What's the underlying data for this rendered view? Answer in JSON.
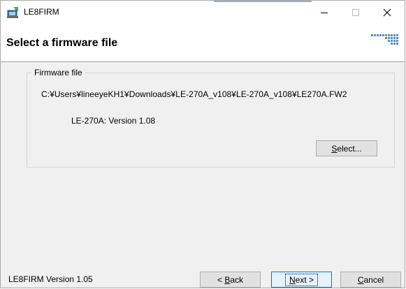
{
  "window": {
    "title": "LE8FIRM",
    "icon": "app-icon",
    "controls": {
      "minimize": "—",
      "maximize": "☐",
      "close": "✕"
    }
  },
  "header": {
    "title": "Select a firmware file",
    "logo": "dot-matrix-logo"
  },
  "firmware_group": {
    "legend": "Firmware file",
    "path": "C:¥Users¥lineeyeKH1¥Downloads¥LE-270A_v108¥LE-270A_v108¥LE270A.FW2",
    "version_info": "LE-270A: Version 1.08",
    "select_button": {
      "prefix": "",
      "accel": "S",
      "rest": "elect..."
    }
  },
  "footer": {
    "version_text": "LE8FIRM Version 1.05",
    "back_button": {
      "prefix": "< ",
      "accel": "B",
      "rest": "ack"
    },
    "next_button": {
      "prefix": "",
      "accel": "N",
      "rest": "ext >"
    },
    "cancel_button": {
      "prefix": "",
      "accel": "C",
      "rest": "ancel"
    }
  },
  "colors": {
    "accent": "#0078d7",
    "button_bg": "#e1e1e1",
    "dialog_bg": "#f0f0f0",
    "logo": "#5b8fbf"
  }
}
